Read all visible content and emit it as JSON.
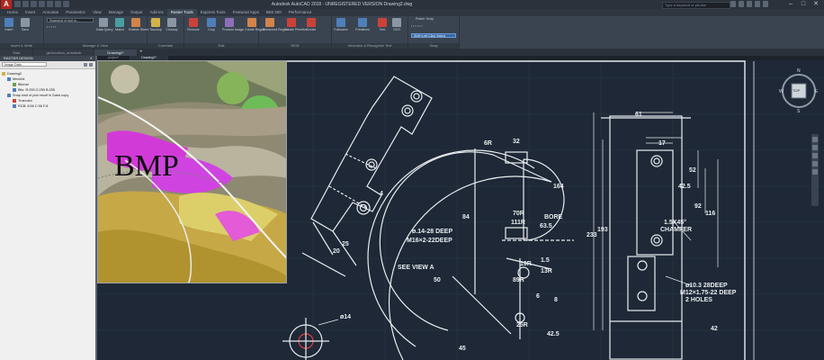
{
  "app": {
    "logo_letter": "A",
    "title": "Autodesk AutoCAD 2018 - UNREGISTERED VERSION  Drawing2.dwg",
    "search_placeholder": "Type a keyword or phrase",
    "window_controls": [
      "–",
      "□",
      "✕"
    ]
  },
  "ribbon_tabs": [
    "Home",
    "Insert",
    "Annotate",
    "Parametric",
    "View",
    "Manage",
    "Output",
    "Add-ins",
    "Raster Tools",
    "Express Tools",
    "Featured Apps",
    "BIM 360",
    "Performance"
  ],
  "active_ribbon_tab": "Raster Tools",
  "ribbon": {
    "panels": [
      {
        "title": "Insert & Write",
        "buttons": [
          "Insert",
          "Save"
        ]
      },
      {
        "title": "Manage & View",
        "dropdown": "Snapshot of plot m...",
        "buttons": [
          "Data Query",
          "Match",
          "Rubber Sheet"
        ]
      },
      {
        "title": "Correlate",
        "buttons": []
      },
      {
        "title": "Edit",
        "buttons": [
          "Touchup",
          "Cleanup",
          "Remove",
          "Crop",
          "Process Image"
        ]
      },
      {
        "title": "REM",
        "buttons": [
          "Create Region",
          "Enhanced Region",
          "Create Primitive",
          "Create"
        ]
      },
      {
        "title": "Vectorize & Recognize Text",
        "buttons": [
          "Followers",
          "Primitives",
          "Text",
          "OCR"
        ]
      },
      {
        "title": "Snap",
        "buttons": [
          "Raster Snap"
        ]
      }
    ],
    "selection_cycle": "Shift+Left Click Select"
  },
  "doc_tabs": [
    "Start",
    "geolocation_autodesk",
    "Drawing2*"
  ],
  "active_doc_tab": "Drawing2*",
  "drawing_tabs": [
    "project*",
    "Drawing2*"
  ],
  "active_drawing_tab": "Drawing2*",
  "raster_panel": {
    "title": "RASTER DESIGN",
    "close": "✕",
    "select_value": "Image Data",
    "tree": [
      {
        "label": "Drawing2",
        "level": 0,
        "icon_color": "#d3b24a"
      },
      {
        "label": "Mechfdi",
        "level": 1,
        "icon_color": "#4f7fb8"
      },
      {
        "label": "Bitonal",
        "level": 2,
        "icon_color": "#6f9e4e"
      },
      {
        "label": "Bits: R:255 G:255 B:255",
        "level": 2,
        "icon_color": "#4f7fb8"
      },
      {
        "label": "Snap shot of plot result in Gatot copy",
        "level": 1,
        "icon_color": "#4f7fb8"
      },
      {
        "label": "Truecolor",
        "level": 2,
        "icon_color": "#c9423a"
      },
      {
        "label": "RGB: 8:56 C:56 F:8",
        "level": 2,
        "icon_color": "#4f7fb8"
      }
    ]
  },
  "viewport": {
    "map_label": "BMP",
    "viewcube": {
      "top": "TOP",
      "north": "N",
      "south": "S",
      "east": "E",
      "west": "W"
    }
  },
  "drawing_annotations": [
    "ø14",
    "ø.14-28 DEEP",
    "M16×2-22DEEP",
    "SEE VIEW A",
    "6R",
    "32",
    "70R",
    "111R",
    "BORE",
    "164",
    "84",
    "63.5",
    "1.5",
    "13R",
    "19R",
    "89R",
    "25R",
    "50",
    "6",
    "8",
    "42.5",
    "61",
    "17",
    "52",
    "42.5",
    "92",
    "116",
    "193",
    "233",
    "45",
    "4",
    "25",
    "20",
    "ø10.3 28DEEP",
    "M12×1.75-22 DEEP",
    "2 HOLES",
    "1.5X45°",
    "CHAMFER",
    "42"
  ],
  "colors": {
    "background": "#1e2836",
    "drawing_lines": "#e8ecef",
    "accent": "#3569a5"
  }
}
